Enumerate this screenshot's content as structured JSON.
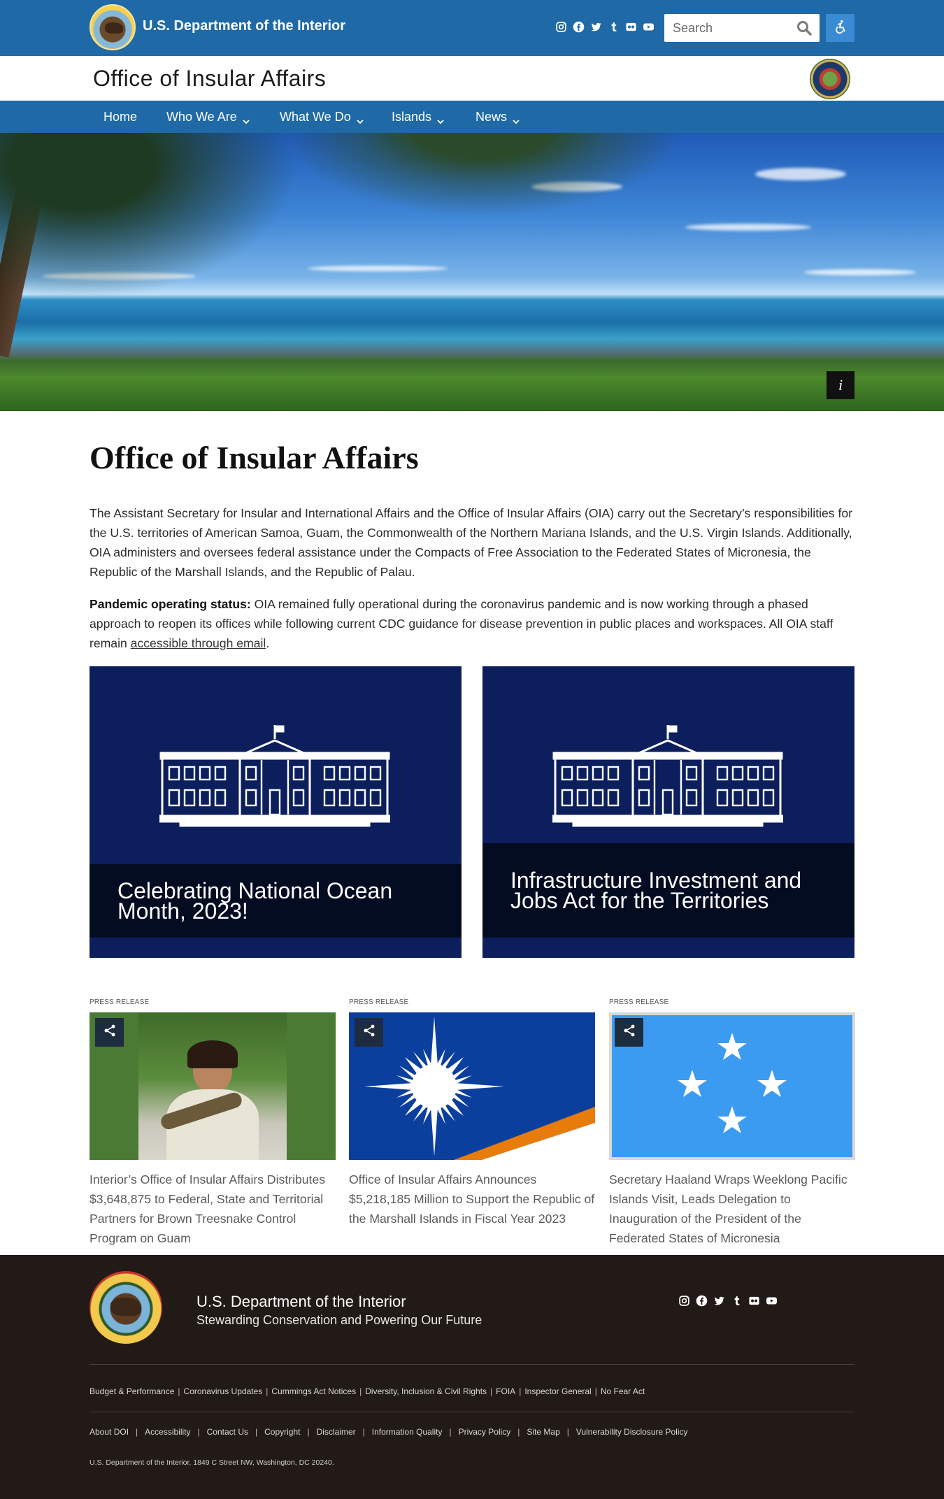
{
  "header": {
    "doi_title": "U.S. Department of the Interior",
    "search_placeholder": "Search",
    "social_icons": [
      "instagram-icon",
      "facebook-icon",
      "twitter-icon",
      "tumblr-icon",
      "flickr-icon",
      "youtube-icon"
    ]
  },
  "office": {
    "name": "Office of Insular Affairs"
  },
  "nav": {
    "items": [
      {
        "label": "Home",
        "dropdown": false
      },
      {
        "label": "Who We Are",
        "dropdown": true
      },
      {
        "label": "What We Do",
        "dropdown": true
      },
      {
        "label": "Islands",
        "dropdown": true
      },
      {
        "label": "News",
        "dropdown": true
      }
    ]
  },
  "hero": {
    "info_label": "i"
  },
  "main": {
    "title": "Office of Insular Affairs",
    "intro": "The Assistant Secretary for Insular and International Affairs and the Office of Insular Affairs (OIA) carry out the Secretary’s responsibilities for the U.S. territories of American Samoa, Guam, the Commonwealth of the Northern Mariana Islands, and the U.S. Virgin Islands. Additionally, OIA administers and oversees federal assistance under the Compacts of Free Association to the Federated States of Micronesia, the Republic of the Marshall Islands, and the Republic of Palau.",
    "status_label": "Pandemic operating status:",
    "status_text": " OIA remained fully operational during the coronavirus pandemic and is now working through a phased approach to reopen its offices while following current CDC guidance for disease prevention in public places and workspaces. All OIA staff remain ",
    "status_link": "accessible through email",
    "status_end": "."
  },
  "features": [
    {
      "title": "Celebrating National Ocean Month, 2023!"
    },
    {
      "title": "Infrastructure Investment and Jobs Act for the Territories"
    }
  ],
  "press": [
    {
      "label": "PRESS RELEASE",
      "title": "Interior’s Office of Insular Affairs Distributes $3,648,875 to Federal, State and Territorial Partners for Brown Treesnake Control Program on Guam"
    },
    {
      "label": "PRESS RELEASE",
      "title": "Office of Insular Affairs Announces $5,218,185 Million to Support the Republic of the Marshall Islands in Fiscal Year 2023"
    },
    {
      "label": "PRESS RELEASE",
      "title": "Secretary Haaland Wraps Weeklong Pacific Islands Visit, Leads Delegation to Inauguration of the President of the Federated States of Micronesia"
    }
  ],
  "footer": {
    "title": "U.S. Department of the Interior",
    "tagline": "Stewarding Conservation and Powering Our Future",
    "links1": [
      "Budget & Performance",
      "Coronavirus Updates",
      "Cummings Act Notices",
      "Diversity, Inclusion & Civil Rights",
      "FOIA",
      "Inspector General",
      "No Fear Act"
    ],
    "links2": [
      "About DOI",
      "Accessibility",
      "Contact Us",
      "Copyright",
      "Disclaimer",
      "Information Quality",
      "Privacy Policy",
      "Site Map",
      "Vulnerability Disclosure Policy"
    ],
    "address": "U.S. Department of the Interior, 1849 C Street NW, Washington, DC 20240."
  },
  "colors": {
    "topbar": "#1f6aa6",
    "feature_bg": "#0c1f5c",
    "feature_caption": "#040c22",
    "footer_bg": "#221a16"
  }
}
